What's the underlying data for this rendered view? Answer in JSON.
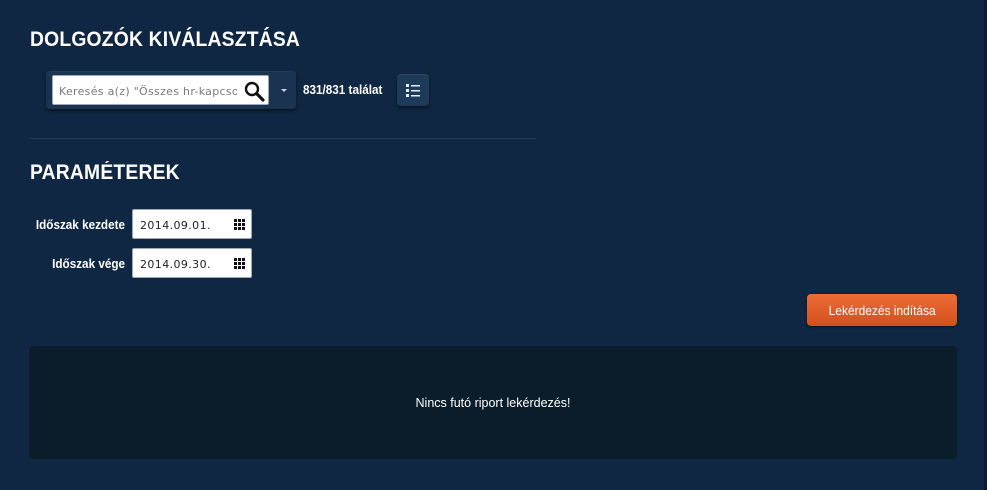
{
  "employees": {
    "title": "DOLGOZÓK KIVÁLASZTÁSA",
    "search_placeholder": "Keresés a(z) \"Összes hr-kapcsolat\"",
    "result_count": "831/831 találat"
  },
  "params": {
    "title": "PARAMÉTEREK",
    "start_label": "Időszak kezdete",
    "start_value": "2014.09.01.",
    "end_label": "Időszak vége",
    "end_value": "2014.09.30."
  },
  "actions": {
    "run_label": "Lekérdezés indítása"
  },
  "report": {
    "message": "Nincs futó riport lekérdezés!"
  },
  "colors": {
    "background": "#0f2742",
    "accent": "#e4602a",
    "panel": "#0b1d2a"
  },
  "icons": {
    "search": "search-icon",
    "dropdown": "chevron-down-icon",
    "list": "list-icon",
    "calendar": "calendar-icon"
  }
}
